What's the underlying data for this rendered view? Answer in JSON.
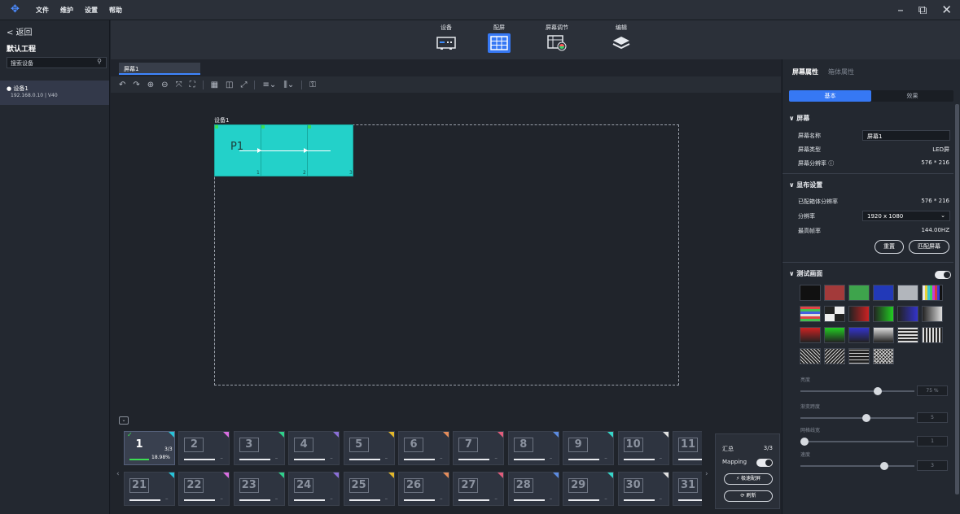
{
  "titlebar": {
    "logo": "✥",
    "menus": [
      "文件",
      "维护",
      "设置",
      "帮助"
    ],
    "win_min": "–",
    "win_restore": "⧉",
    "win_close": "✕"
  },
  "left": {
    "back_label": "< 返回",
    "project_name": "默认工程",
    "search_placeholder": "搜索设备",
    "device_name": "● 设备1",
    "device_ip": "192.168.0.10 | V40"
  },
  "nav": {
    "items": [
      {
        "label": "设备"
      },
      {
        "label": "配屏"
      },
      {
        "label": "屏幕调节"
      },
      {
        "label": "编辑"
      }
    ]
  },
  "canvas": {
    "tab_label": "屏幕1",
    "device_label": "设备1",
    "screen_label": "P1",
    "cell_numbers": [
      "1",
      "2",
      "3"
    ]
  },
  "bottom": {
    "cards_row1": [
      "1",
      "2",
      "3",
      "4",
      "5",
      "6",
      "7",
      "8",
      "9",
      "10",
      "11"
    ],
    "cards_row2": [
      "21",
      "22",
      "23",
      "24",
      "25",
      "26",
      "27",
      "28",
      "29",
      "30",
      "31"
    ],
    "first_count": "3/3",
    "first_percent": "18.98%",
    "corner_colors": [
      "#27c3d8",
      "#d86ee0",
      "#2fd08a",
      "#8a6fd6",
      "#e2b72a",
      "#e48c5b",
      "#e05c7a",
      "#5c8be0",
      "#36d6c8",
      "#e0e0e0",
      "#3bd46b"
    ],
    "summary_label": "汇总",
    "summary_value": "3/3",
    "mapping_label": "Mapping",
    "quick_btn": "⚡ 极速配屏",
    "refresh_btn": "⟳ 刷新"
  },
  "right": {
    "tab_active": "屏幕属性",
    "tab_inactive": "箱体属性",
    "seg_basic": "基本",
    "seg_effect": "效果",
    "sec_screen": "∨ 屏幕",
    "screen_name_label": "屏幕名称",
    "screen_name_value": "屏幕1",
    "screen_type_label": "屏幕类型",
    "screen_type_value": "LED屏",
    "screen_res_label": "屏幕分辨率 ⓘ",
    "screen_res_value": "576 * 216",
    "sec_layout": "∨ 显布设置",
    "matched_res_label": "已配箱体分辨率",
    "matched_res_value": "576 * 216",
    "resolution_label": "分辨率",
    "resolution_value": "1920 x 1080",
    "refresh_rate_label": "最高帧率",
    "refresh_rate_value": "144.00HZ",
    "reset_btn": "重置",
    "match_btn": "匹配屏幕",
    "sec_test": "∨ 测试画面",
    "brightness_label": "亮度",
    "brightness_value": "75 %",
    "gradient_label": "渐变跨度",
    "gradient_value": "5",
    "grid_label": "网格线宽",
    "grid_value": "1",
    "speed_label": "速度",
    "speed_value": "3"
  }
}
